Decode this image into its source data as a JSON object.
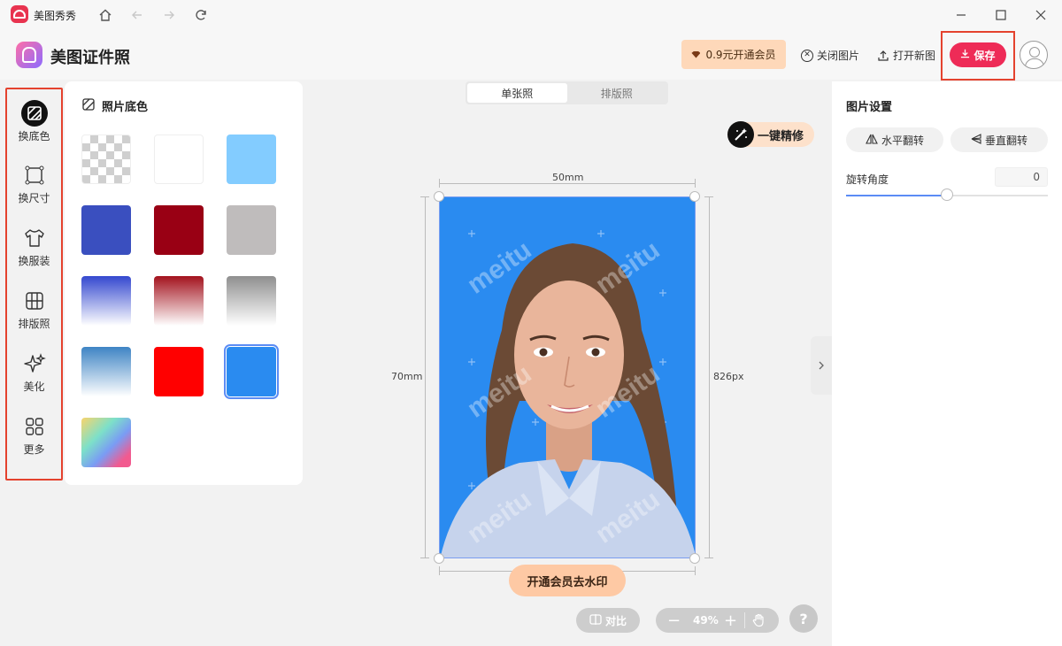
{
  "titlebar": {
    "app_name": "美图秀秀"
  },
  "header": {
    "product_title": "美图证件照",
    "vip_label": "0.9元开通会员",
    "close_image_label": "关闭图片",
    "open_new_label": "打开新图",
    "save_label": "保存"
  },
  "sidebar": {
    "items": [
      {
        "label": "换底色",
        "icon": "background-color-icon"
      },
      {
        "label": "换尺寸",
        "icon": "resize-icon"
      },
      {
        "label": "换服装",
        "icon": "tshirt-icon"
      },
      {
        "label": "排版照",
        "icon": "layout-grid-icon"
      },
      {
        "label": "美化",
        "icon": "sparkle-icon"
      },
      {
        "label": "更多",
        "icon": "more-grid-icon"
      }
    ]
  },
  "color_panel": {
    "title": "照片底色",
    "swatches": [
      {
        "name": "transparent",
        "fill": "checker"
      },
      {
        "name": "white",
        "fill": "#ffffff"
      },
      {
        "name": "light-blue",
        "fill": "#83ccff"
      },
      {
        "name": "blue",
        "fill": "#3a4fbf"
      },
      {
        "name": "dark-red",
        "fill": "#990014"
      },
      {
        "name": "gray",
        "fill": "#bfbcbc"
      },
      {
        "name": "blue-gradient",
        "fill": "linear-gradient(#3448cf,#ffffff)"
      },
      {
        "name": "red-gradient",
        "fill": "linear-gradient(#a3121d,#ffffff)"
      },
      {
        "name": "gray-gradient",
        "fill": "linear-gradient(#8f8f8f,#ffffff)"
      },
      {
        "name": "sky-gradient",
        "fill": "linear-gradient(#3e84c4,#ffffff)"
      },
      {
        "name": "red",
        "fill": "#ff0000"
      },
      {
        "name": "bright-blue",
        "fill": "#2a8bf0",
        "selected": true
      },
      {
        "name": "rainbow",
        "fill": "conic"
      }
    ]
  },
  "canvas": {
    "tabs": [
      "单张照",
      "排版照"
    ],
    "active_tab": 0,
    "enhance_label": "一键精修",
    "width_mm": "50mm",
    "height_mm": "70mm",
    "height_px": "826px",
    "watermark_text": "meitu",
    "remove_watermark_label": "开通会员去水印",
    "compare_label": "对比",
    "zoom_label": "49%",
    "help_label": "?",
    "photo_bg": "#2a8bf0"
  },
  "right_panel": {
    "title": "图片设置",
    "flip_h_label": "水平翻转",
    "flip_v_label": "垂直翻转",
    "rotate_label": "旋转角度",
    "rotate_value": "0",
    "rotate_slider_fraction": 0.5
  },
  "colors": {
    "accent": "#ee2b57",
    "highlight": "#e4422e",
    "selection": "#5b8cf5"
  }
}
